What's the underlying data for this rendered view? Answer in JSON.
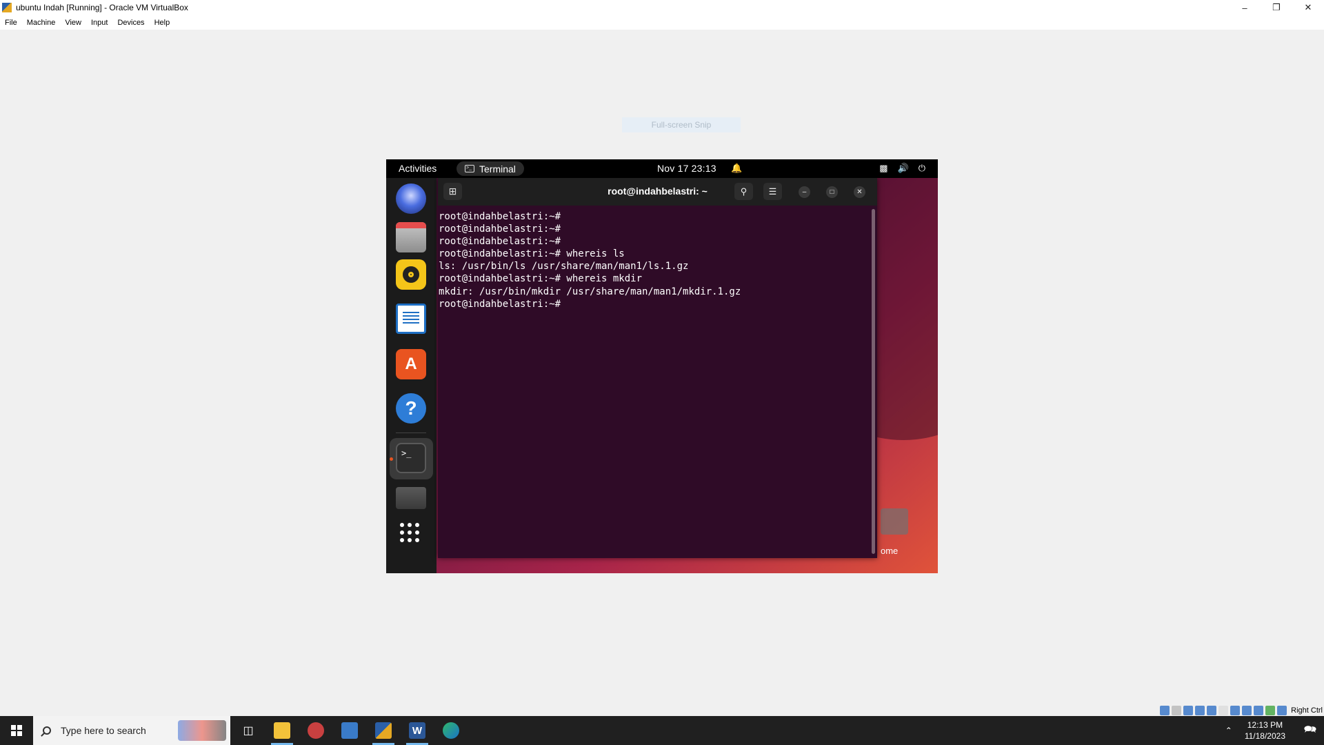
{
  "host": {
    "window_title": "ubuntu Indah [Running] - Oracle VM VirtualBox",
    "window_controls": {
      "minimize": "–",
      "restore": "❐",
      "close": "✕"
    },
    "menu": [
      "File",
      "Machine",
      "View",
      "Input",
      "Devices",
      "Help"
    ],
    "snip_hint": "Full-screen Snip",
    "host_key": "Right Ctrl"
  },
  "guest": {
    "topbar": {
      "activities": "Activities",
      "app_name": "Terminal",
      "clock": "Nov 17  23:13"
    },
    "desktop": {
      "home_label": "ome"
    },
    "terminal": {
      "title": "root@indahbelastri: ~",
      "lines": [
        "root@indahbelastri:~#",
        "root@indahbelastri:~#",
        "root@indahbelastri:~#",
        "root@indahbelastri:~# whereis ls",
        "ls: /usr/bin/ls /usr/share/man/man1/ls.1.gz",
        "root@indahbelastri:~# whereis mkdir",
        "mkdir: /usr/bin/mkdir /usr/share/man/man1/mkdir.1.gz",
        "root@indahbelastri:~#"
      ]
    },
    "dock": [
      "thunderbird-icon",
      "files-icon",
      "rhythmbox-icon",
      "libreoffice-writer-icon",
      "app-center-icon",
      "help-icon",
      "terminal-icon",
      "drive-icon",
      "show-apps-icon"
    ]
  },
  "taskbar": {
    "search_placeholder": "Type here to search",
    "time": "12:13 PM",
    "date": "11/18/2023",
    "apps": [
      "task-view-icon",
      "file-explorer-icon",
      "app-icon",
      "virtualbox-icon",
      "virtualbox-vm-icon",
      "word-icon",
      "edge-icon"
    ]
  },
  "colors": {
    "ubuntu_orange": "#e95420",
    "terminal_bg": "#2f0b27",
    "taskbar_bg": "#202020"
  }
}
